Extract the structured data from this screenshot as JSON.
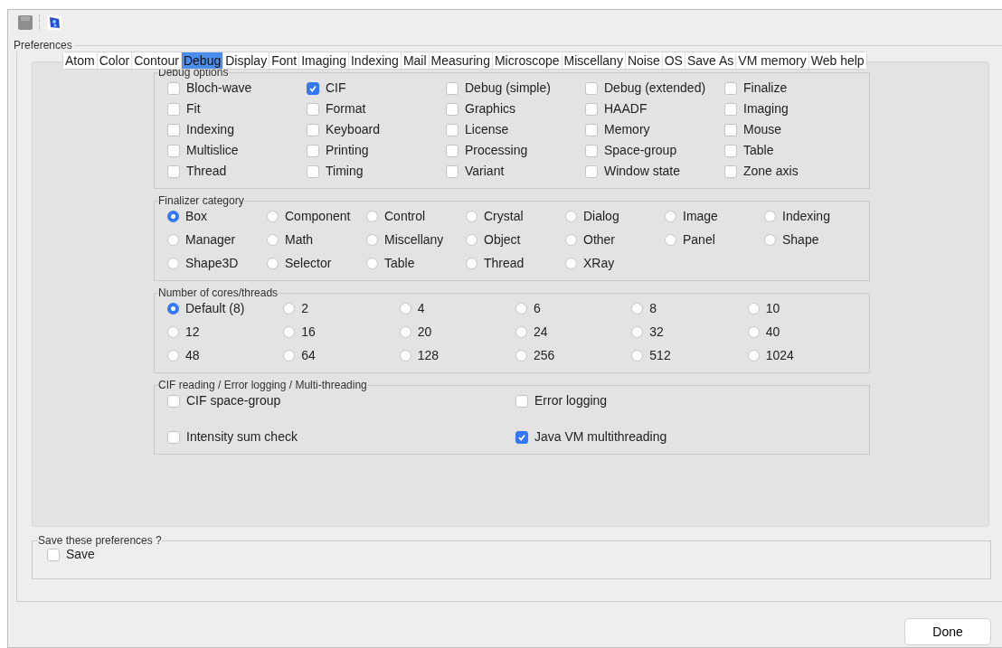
{
  "preferences": {
    "title": "Preferences",
    "tabs": [
      {
        "label": "Atom",
        "selected": false
      },
      {
        "label": "Color",
        "selected": false
      },
      {
        "label": "Contour",
        "selected": false
      },
      {
        "label": "Debug",
        "selected": true
      },
      {
        "label": "Display",
        "selected": false
      },
      {
        "label": "Font",
        "selected": false
      },
      {
        "label": "Imaging",
        "selected": false
      },
      {
        "label": "Indexing",
        "selected": false
      },
      {
        "label": "Mail",
        "selected": false
      },
      {
        "label": "Measuring",
        "selected": false
      },
      {
        "label": "Microscope",
        "selected": false
      },
      {
        "label": "Miscellany",
        "selected": false
      },
      {
        "label": "Noise",
        "selected": false
      },
      {
        "label": "OS",
        "selected": false
      },
      {
        "label": "Save As",
        "selected": false
      },
      {
        "label": "VM memory",
        "selected": false
      },
      {
        "label": "Web help",
        "selected": false
      }
    ],
    "groups": [
      {
        "title": "Debug options",
        "kind": "checkbox",
        "rows": [
          [
            {
              "label": "Bloch-wave",
              "checked": false
            },
            {
              "label": "CIF",
              "checked": true
            },
            {
              "label": "Debug (simple)",
              "checked": false
            },
            {
              "label": "Debug (extended)",
              "checked": false
            },
            {
              "label": "Finalize",
              "checked": false
            }
          ],
          [
            {
              "label": "Fit",
              "checked": false
            },
            {
              "label": "Format",
              "checked": false
            },
            {
              "label": "Graphics",
              "checked": false
            },
            {
              "label": "HAADF",
              "checked": false
            },
            {
              "label": "Imaging",
              "checked": false
            }
          ],
          [
            {
              "label": "Indexing",
              "checked": false
            },
            {
              "label": "Keyboard",
              "checked": false
            },
            {
              "label": "License",
              "checked": false
            },
            {
              "label": "Memory",
              "checked": false
            },
            {
              "label": "Mouse",
              "checked": false
            }
          ],
          [
            {
              "label": "Multislice",
              "checked": false
            },
            {
              "label": "Printing",
              "checked": false
            },
            {
              "label": "Processing",
              "checked": false
            },
            {
              "label": "Space-group",
              "checked": false
            },
            {
              "label": "Table",
              "checked": false
            }
          ],
          [
            {
              "label": "Thread",
              "checked": false
            },
            {
              "label": "Timing",
              "checked": false
            },
            {
              "label": "Variant",
              "checked": false
            },
            {
              "label": "Window state",
              "checked": false
            },
            {
              "label": "Zone axis",
              "checked": false
            }
          ]
        ]
      },
      {
        "title": "Finalizer category",
        "kind": "radio",
        "rows": [
          [
            {
              "label": "Box",
              "selected": true
            },
            {
              "label": "Component",
              "selected": false
            },
            {
              "label": "Control",
              "selected": false
            },
            {
              "label": "Crystal",
              "selected": false
            },
            {
              "label": "Dialog",
              "selected": false
            },
            {
              "label": "Image",
              "selected": false
            },
            {
              "label": "Indexing",
              "selected": false
            }
          ],
          [
            {
              "label": "Manager",
              "selected": false
            },
            {
              "label": "Math",
              "selected": false
            },
            {
              "label": "Miscellany",
              "selected": false
            },
            {
              "label": "Object",
              "selected": false
            },
            {
              "label": "Other",
              "selected": false
            },
            {
              "label": "Panel",
              "selected": false
            },
            {
              "label": "Shape",
              "selected": false
            }
          ],
          [
            {
              "label": "Shape3D",
              "selected": false
            },
            {
              "label": "Selector",
              "selected": false
            },
            {
              "label": "Table",
              "selected": false
            },
            {
              "label": "Thread",
              "selected": false
            },
            {
              "label": "XRay",
              "selected": false
            }
          ]
        ]
      },
      {
        "title": "Number of cores/threads",
        "kind": "radio",
        "rows": [
          [
            {
              "label": "Default (8)",
              "selected": true
            },
            {
              "label": "2",
              "selected": false
            },
            {
              "label": "4",
              "selected": false
            },
            {
              "label": "6",
              "selected": false
            },
            {
              "label": "8",
              "selected": false
            },
            {
              "label": "10",
              "selected": false
            }
          ],
          [
            {
              "label": "12",
              "selected": false
            },
            {
              "label": "16",
              "selected": false
            },
            {
              "label": "20",
              "selected": false
            },
            {
              "label": "24",
              "selected": false
            },
            {
              "label": "32",
              "selected": false
            },
            {
              "label": "40",
              "selected": false
            }
          ],
          [
            {
              "label": "48",
              "selected": false
            },
            {
              "label": "64",
              "selected": false
            },
            {
              "label": "128",
              "selected": false
            },
            {
              "label": "256",
              "selected": false
            },
            {
              "label": "512",
              "selected": false
            },
            {
              "label": "1024",
              "selected": false
            }
          ]
        ]
      },
      {
        "title": "CIF reading / Error logging / Multi-threading",
        "kind": "checkbox",
        "rows": [
          [
            {
              "label": "CIF space-group",
              "checked": false
            },
            {
              "label": "Error logging",
              "checked": false
            }
          ],
          [
            {
              "label": "Intensity sum check",
              "checked": false
            },
            {
              "label": "Java VM multithreading",
              "checked": true
            }
          ]
        ]
      }
    ]
  },
  "save_group": {
    "title": "Save these preferences ?",
    "items": [
      {
        "label": "Save",
        "checked": false
      }
    ]
  },
  "buttons": [
    "Done"
  ]
}
